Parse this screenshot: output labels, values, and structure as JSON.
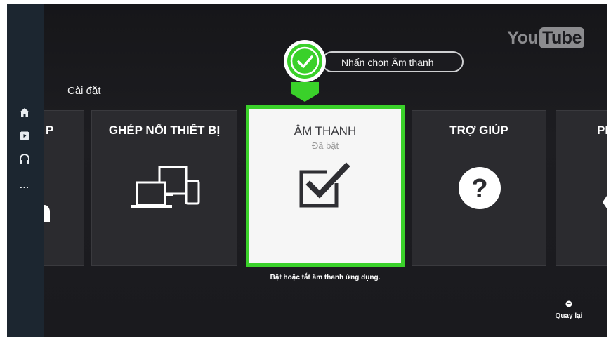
{
  "brand": {
    "logo_you": "You",
    "logo_tube": "Tube"
  },
  "sidebar": {
    "items": [
      {
        "icon": "home-icon"
      },
      {
        "icon": "subscriptions-icon"
      },
      {
        "icon": "headphones-icon"
      },
      {
        "icon": "more-dots-icon",
        "label": "..."
      }
    ]
  },
  "page": {
    "title": "Cài đặt"
  },
  "callout": {
    "text": "Nhấn chọn Âm thanh",
    "icon": "check-circle-icon",
    "accent": "#3ad12a"
  },
  "tiles": [
    {
      "title": "P",
      "icon": "partial-icon"
    },
    {
      "title": "GHÉP NỐI THIẾT BỊ",
      "icon": "devices-icon"
    },
    {
      "title": "ÂM THANH",
      "status": "Đã bật",
      "hint": "Bật hoặc tắt âm thanh ứng dụng.",
      "icon": "checkbox-checked-icon",
      "selected": true
    },
    {
      "title": "TRỢ GIÚP",
      "icon": "help-icon"
    },
    {
      "title": "PH",
      "icon": "partial-icon"
    }
  ],
  "footer": {
    "back_label": "Quay lại",
    "back_icon": "back-dot-icon"
  }
}
